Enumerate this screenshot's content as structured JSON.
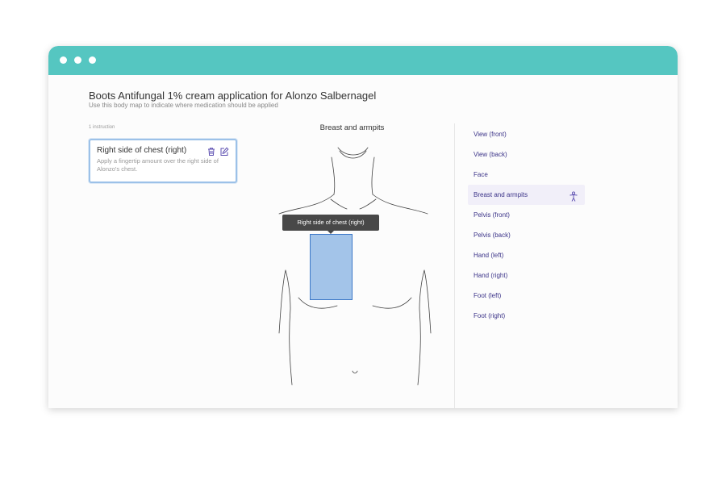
{
  "page": {
    "title": "Boots Antifungal 1% cream application for Alonzo Salbernagel",
    "subtitle": "Use this body map to indicate where medication should be applied"
  },
  "instructions": {
    "count_label": "1 instruction",
    "items": [
      {
        "title": "Right side of chest (right)",
        "description": "Apply a fingertip amount over the right side of Alonzo's chest."
      }
    ]
  },
  "body_map": {
    "title": "Breast and armpits",
    "tooltip": "Right side of chest (right)",
    "highlight_color": "#a3c4e9",
    "highlight_border": "#3c78c8"
  },
  "views": {
    "items": [
      {
        "label": "View (front)"
      },
      {
        "label": "View (back)"
      },
      {
        "label": "Face"
      },
      {
        "label": "Breast and armpits",
        "active": true,
        "icon": "person-icon"
      },
      {
        "label": "Pelvis (front)"
      },
      {
        "label": "Pelvis (back)"
      },
      {
        "label": "Hand (left)"
      },
      {
        "label": "Hand (right)"
      },
      {
        "label": "Foot (left)"
      },
      {
        "label": "Foot (right)"
      }
    ]
  },
  "theme": {
    "titlebar_color": "#55c6c1",
    "accent_text": "#3b3388",
    "active_bg": "#f1eff9"
  }
}
